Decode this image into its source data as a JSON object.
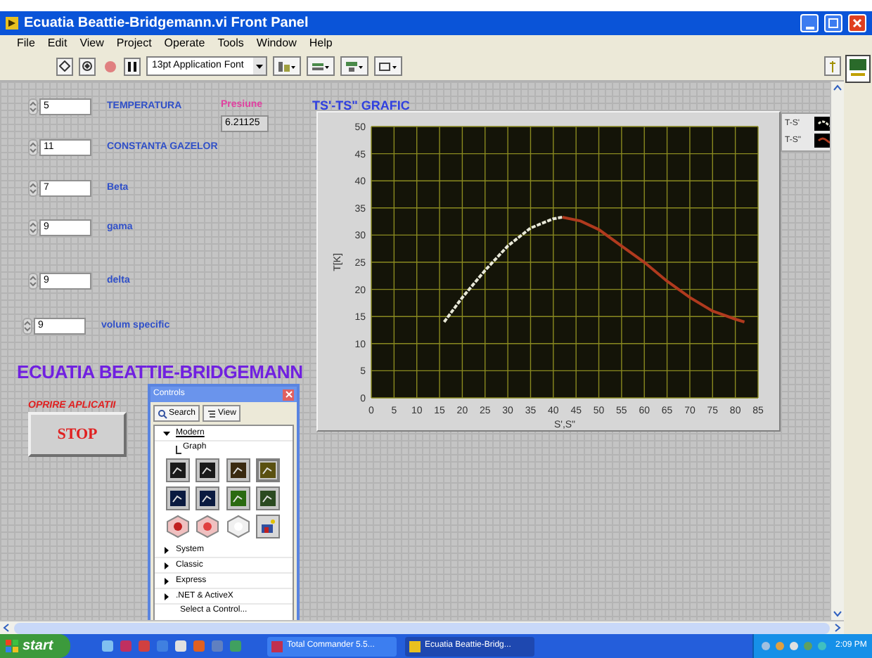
{
  "window": {
    "title": "Ecuatia Beattie-Bridgemann.vi Front Panel"
  },
  "menu": [
    "File",
    "Edit",
    "View",
    "Project",
    "Operate",
    "Tools",
    "Window",
    "Help"
  ],
  "toolbar": {
    "font": "13pt Application Font"
  },
  "controls": [
    {
      "label": "TEMPERATURA",
      "value": "5"
    },
    {
      "label": "CONSTANTA GAZELOR",
      "value": "11"
    },
    {
      "label": "Beta",
      "value": "7"
    },
    {
      "label": "gama",
      "value": "9"
    },
    {
      "label": "delta",
      "value": "9"
    },
    {
      "label": "volum specific",
      "value": "9"
    }
  ],
  "indicator": {
    "label": "Presiune",
    "value": "6.21125"
  },
  "heading": "ECUATIA BEATTIE-BRIDGEMANN",
  "stop": {
    "caption": "OPRIRE APLICATII",
    "label": "STOP"
  },
  "graph": {
    "title": "TS'-TS\" GRAFIC",
    "chart_data": {
      "type": "line",
      "xlabel": "S',S\"",
      "ylabel": "T[K]",
      "grid": true,
      "x": [
        16,
        20,
        25,
        30,
        35,
        40,
        42,
        46,
        50,
        55,
        60,
        65,
        70,
        75,
        80,
        82
      ],
      "series": [
        {
          "name": "T-S'",
          "color": "#e8e8d8",
          "line_style": "dashed",
          "values": [
            14,
            18.5,
            23.5,
            28,
            31.3,
            33,
            33.3,
            null,
            null,
            null,
            null,
            null,
            null,
            null,
            null,
            null
          ]
        },
        {
          "name": "T-S\"",
          "color": "#b03a1e",
          "line_style": "solid",
          "values": [
            null,
            null,
            null,
            null,
            null,
            null,
            33.3,
            32.6,
            31,
            28,
            25,
            21.5,
            18.5,
            16,
            14.5,
            14
          ]
        }
      ],
      "xlim": [
        0,
        85
      ],
      "ylim": [
        0,
        50
      ],
      "xticks": [
        0,
        5,
        10,
        15,
        20,
        25,
        30,
        35,
        40,
        45,
        50,
        55,
        60,
        65,
        70,
        75,
        80,
        85
      ],
      "yticks": [
        0,
        5,
        10,
        15,
        20,
        25,
        30,
        35,
        40,
        45,
        50
      ]
    }
  },
  "palette": {
    "title": "Controls",
    "buttons": [
      "Search",
      "View"
    ],
    "tree": [
      {
        "label": "Modern",
        "expanded": true,
        "children": [
          {
            "label": "Graph"
          }
        ]
      },
      {
        "label": "System",
        "expanded": false
      },
      {
        "label": "Classic",
        "expanded": false
      },
      {
        "label": "Express",
        "expanded": false
      },
      {
        "label": ".NET & ActiveX",
        "expanded": false
      }
    ],
    "footer": "Select a Control..."
  },
  "taskbar": {
    "start": "start",
    "tasks": [
      {
        "label": "Total Commander 5.5...",
        "selected": false
      },
      {
        "label": "Ecuatia Beattie-Bridg...",
        "selected": true
      }
    ],
    "clock": "2:09 PM"
  }
}
